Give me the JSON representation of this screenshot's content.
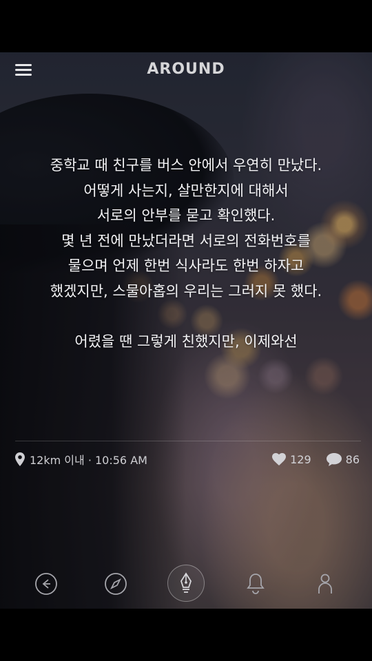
{
  "header": {
    "app_title": "AROUND",
    "menu_icon": "hamburger-menu-icon"
  },
  "post": {
    "lines": [
      "중학교 때 친구를 버스 안에서 우연히 만났다.",
      "어떻게 사는지, 살만한지에 대해서",
      "서로의 안부를 묻고 확인했다.",
      "몇 년 전에 만났더라면 서로의 전화번호를",
      "물으며 언제 한번 식사라도 한번 하자고",
      "했겠지만, 스물아홉의 우리는 그러지 못 했다."
    ],
    "closing_line": "어렸을 땐 그렇게 친했지만, 이제와선"
  },
  "meta": {
    "location_icon": "location-pin-icon",
    "location_time": "12km 이내 · 10:56 AM"
  },
  "stats": {
    "likes_icon": "heart-icon",
    "likes": "129",
    "comments_icon": "chat-bubble-icon",
    "comments": "86"
  },
  "nav": {
    "items": [
      "back-arrow-icon",
      "compass-icon",
      "pen-nib-icon",
      "bell-icon",
      "person-icon"
    ],
    "active": "pen-nib-icon"
  },
  "colors": {
    "text": "#f3f3f5",
    "muted": "#cfcfd3",
    "icon": "#a6a6ac"
  }
}
